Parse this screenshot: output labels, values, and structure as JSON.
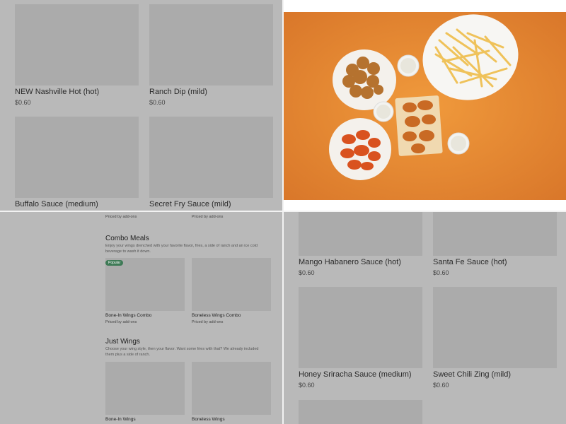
{
  "menu_top_left": [
    {
      "name": "NEW Nashville Hot (hot)",
      "price": "$0.60"
    },
    {
      "name": "Ranch Dip (mild)",
      "price": "$0.60"
    },
    {
      "name": "Buffalo Sauce (medium)",
      "price": ""
    },
    {
      "name": "Secret Fry Sauce (mild)",
      "price": ""
    }
  ],
  "menu_bottom_left": {
    "top_prices": [
      "Priced by add-ons",
      "Priced by add-ons"
    ],
    "combo": {
      "title": "Combo Meals",
      "description": "Enjoy your wings drenched with your favorite flavor, fries, a side of ranch and an ice cold beverage to wash it down.",
      "badge": "Popular",
      "items": [
        {
          "name": "Bone-In Wings Combo",
          "price": "Priced by add-ons"
        },
        {
          "name": "Boneless Wings Combo",
          "price": "Priced by add-ons"
        }
      ]
    },
    "just_wings": {
      "title": "Just Wings",
      "description": "Choose your wing style, then your flavor. Want some fries with that? We already included them plus a side of ranch.",
      "items": [
        {
          "name": "Bone-In Wings",
          "price": ""
        },
        {
          "name": "Boneless Wings",
          "price": ""
        }
      ]
    }
  },
  "menu_bottom_right": [
    {
      "name": "Mango Habanero Sauce (hot)",
      "price": "$0.60"
    },
    {
      "name": "Santa Fe Sauce (hot)",
      "price": "$0.60"
    },
    {
      "name": "Honey Sriracha Sauce (medium)",
      "price": "$0.60"
    },
    {
      "name": "Sweet Chili Zing (mild)",
      "price": "$0.60"
    }
  ],
  "colors": {
    "placeholder": "#ababab",
    "background": "#b9b9b9",
    "badge": "#3e7a56",
    "photo_bg": "#e8892f"
  },
  "photo": {
    "icon": "food-photo-wings-fries"
  }
}
